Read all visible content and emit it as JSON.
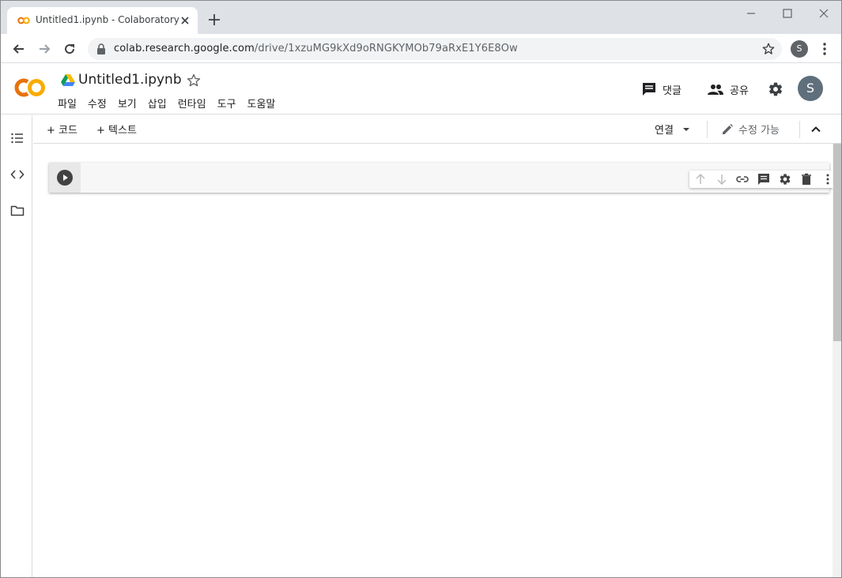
{
  "browser": {
    "tab_title": "Untitled1.ipynb - Colaboratory",
    "url_host": "colab.research.google.com",
    "url_path": "/drive/1xzuMG9kXd9oRNGKYMOb79aRxE1Y6E8Ow",
    "profile_initial": "S"
  },
  "header": {
    "notebook_title": "Untitled1.ipynb",
    "menu": [
      "파일",
      "수정",
      "보기",
      "삽입",
      "런타임",
      "도구",
      "도움말"
    ],
    "comments_label": "댓글",
    "share_label": "공유",
    "avatar_initial": "S"
  },
  "toolbar": {
    "add_code_label": "+ 코드",
    "add_text_label": "+ 텍스트",
    "connect_label": "연결",
    "edit_mode_label": "수정 가능"
  },
  "colors": {
    "colab_orange": "#f9ab00",
    "colab_dark_orange": "#e8710a",
    "icon_gray": "#5f6368"
  }
}
